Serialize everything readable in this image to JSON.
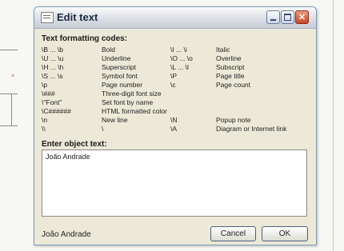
{
  "window": {
    "title": "Edit text",
    "icon": "document-icon"
  },
  "titlebar_buttons": {
    "minimize": "minimize-icon",
    "maximize": "maximize-icon",
    "close": "✕"
  },
  "codes_section": {
    "label": "Text formatting codes:"
  },
  "codes": [
    {
      "code1": "\\B ... \\b",
      "desc1": "Bold",
      "code2": "\\I ... \\i",
      "desc2": "Italic"
    },
    {
      "code1": "\\U ... \\u",
      "desc1": "Underline",
      "code2": "\\O ... \\o",
      "desc2": "Overline"
    },
    {
      "code1": "\\H ... \\h",
      "desc1": "Superscript",
      "code2": "\\L ... \\l",
      "desc2": "Subscript"
    },
    {
      "code1": "\\S ... \\s",
      "desc1": "Symbol font",
      "code2": "\\P",
      "desc2": "Page title"
    },
    {
      "code1": "\\p",
      "desc1": "Page number",
      "code2": "\\c",
      "desc2": "Page count"
    },
    {
      "code1": "\\###",
      "desc1": "Three-digit font size",
      "code2": "",
      "desc2": ""
    },
    {
      "code1": "\\\"Font\"",
      "desc1": "Set font by name",
      "code2": "",
      "desc2": ""
    },
    {
      "code1": "\\C######",
      "desc1": "HTML formatted color",
      "code2": "",
      "desc2": ""
    },
    {
      "code1": "\\n",
      "desc1": "New line",
      "code2": "\\N",
      "desc2": "Popup note"
    },
    {
      "code1": "\\\\",
      "desc1": "\\",
      "code2": "\\A",
      "desc2": "Diagram or Internet link"
    }
  ],
  "object_text": {
    "label": "Enter object text:",
    "value": "João Andrade"
  },
  "preview": {
    "text": "João Andrade"
  },
  "buttons": {
    "cancel": "Cancel",
    "ok": "OK"
  },
  "colors": {
    "close_button": "#c6452a",
    "window_border": "#7f9db9",
    "dialog_bg": "#ece9d8"
  }
}
